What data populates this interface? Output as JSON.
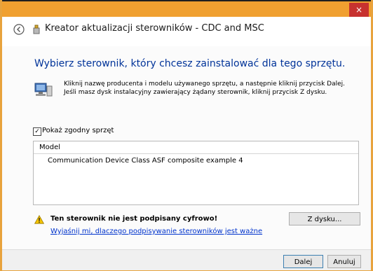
{
  "window": {
    "title": "Kreator aktualizacji sterowników - CDC and MSC",
    "close_glyph": "×",
    "icons": {
      "back": "back-arrow-icon",
      "title_icon": "usb-device-icon"
    }
  },
  "page": {
    "heading": "Wybierz sterownik, który chcesz zainstalować dla tego sprzętu.",
    "instruction": "Kliknij nazwę producenta i modelu używanego sprzętu, a następnie kliknij przycisk Dalej. Jeśli masz dysk instalacyjny zawierający żądany sterownik, kliknij przycisk Z dysku.",
    "instruction_icon": "computer-hardware-icon"
  },
  "compatible": {
    "label": "Pokaż zgodny sprzęt",
    "checked": true,
    "check_glyph": "✓"
  },
  "model_list": {
    "column_header": "Model",
    "items": [
      "Communication Device Class ASF composite example 4"
    ]
  },
  "warning": {
    "icon": "warning-icon",
    "text": "Ten sterownik nie jest podpisany cyfrowo!",
    "link": "Wyjaśnij mi, dlaczego podpisywanie sterowników jest ważne"
  },
  "buttons": {
    "have_disk": "Z dysku...",
    "next": "Dalej",
    "cancel": "Anuluj"
  },
  "colors": {
    "title_bar": "#f0a030",
    "close": "#c7322f",
    "heading": "#003399",
    "link": "#0033cc"
  }
}
